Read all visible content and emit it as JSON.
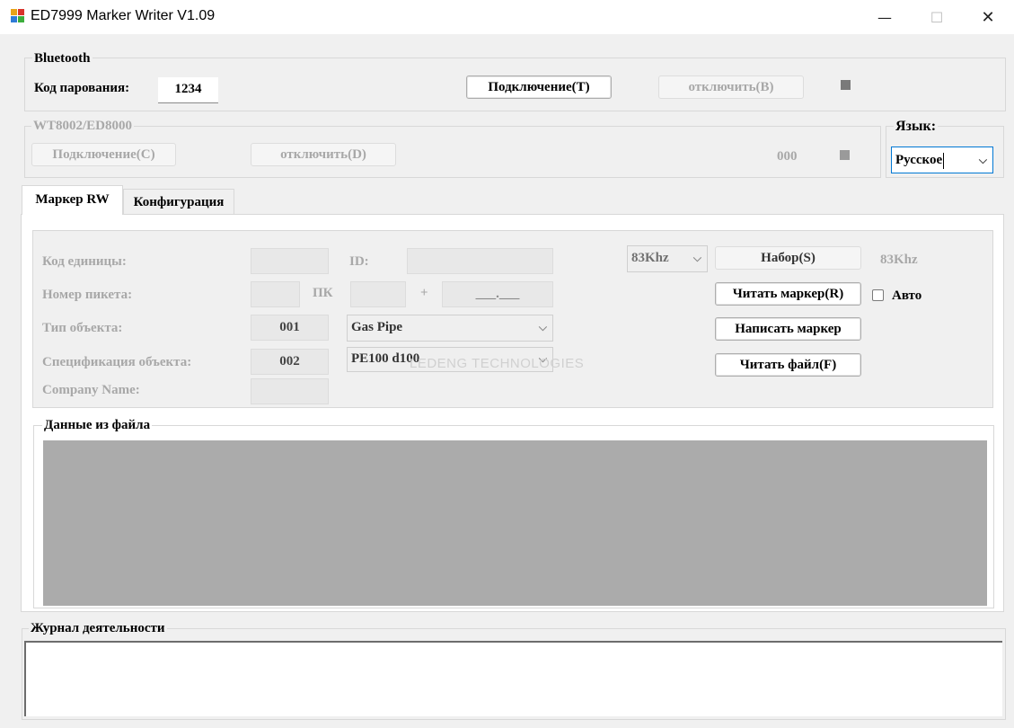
{
  "window": {
    "title": "ED7999 Marker Writer V1.09",
    "minimize": "—",
    "maximize": "☐",
    "close": "✕"
  },
  "bluetooth": {
    "label": "Bluetooth",
    "pairing_label": "Код парования:",
    "pairing_value": "1234",
    "connect_label": "Подключение(T)",
    "disconnect_label": "отключить(B)"
  },
  "wt": {
    "label": "WT8002/ED8000",
    "connect_label": "Подключение(C)",
    "disconnect_label": "отключить(D)",
    "counter": "000"
  },
  "language": {
    "label": "Язык:",
    "selected": "Русское"
  },
  "tabs": [
    {
      "label": "Маркер RW"
    },
    {
      "label": "Конфигурация"
    }
  ],
  "marker": {
    "unit_code_label": "Код единицы:",
    "id_label": "ID:",
    "picket_label": "Номер пикета:",
    "pk_label": "ПК",
    "plus_label": "+",
    "picket_format": "___.___",
    "object_type_label": "Тип объекта:",
    "object_type_code": "001",
    "object_type_value": "Gas Pipe",
    "object_spec_label": "Спецификация объекта:",
    "object_spec_code": "002",
    "object_spec_value": "PE100 d100",
    "company_label": "Company Name:",
    "frequency_select": "83Khz",
    "set_button": "Набор(S)",
    "frequency_display": "83Khz",
    "read_marker_button": "Читать маркер(R)",
    "auto_label": "Авто",
    "write_marker_button": "Написать маркер",
    "read_file_button": "Читать файл(F)",
    "watermark": "LEDENG TECHNOLOGIES"
  },
  "file_data": {
    "label": "Данные из файла"
  },
  "activity_log": {
    "label": "Журнал деятельности"
  }
}
